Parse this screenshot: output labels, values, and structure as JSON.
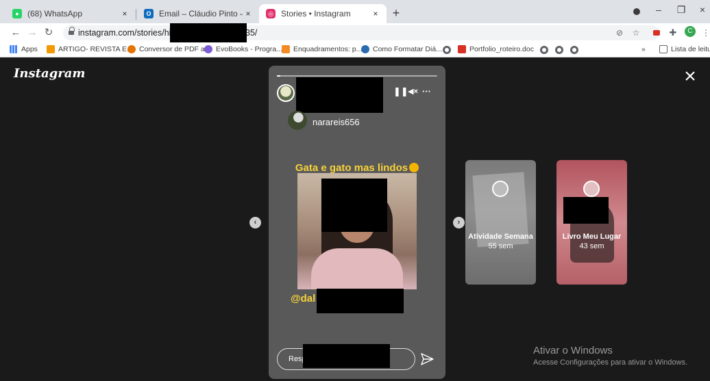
{
  "browser": {
    "tabs": [
      {
        "title": "(68) WhatsApp",
        "close": "×",
        "icon": "whatsapp-icon",
        "color": "#25d366",
        "active": false
      },
      {
        "title": "Email – Cláudio Pinto – Outlook",
        "close": "×",
        "icon": "outlook-icon",
        "color": "#0f6cbd",
        "active": false
      },
      {
        "title": "Stories • Instagram",
        "close": "×",
        "icon": "instagram-icon",
        "color": "#e1306c",
        "active": true
      }
    ],
    "new_tab": "+",
    "window_controls": {
      "minimize": "–",
      "maximize": "❐",
      "close": "×"
    },
    "address": {
      "url_start": "instagram.com/stories/hi",
      "url_end": "35/"
    },
    "bookmarks": [
      {
        "label": "Apps",
        "color": "#4285f4"
      },
      {
        "label": "ARTIGO- REVISTA E...",
        "color": "#f29900"
      },
      {
        "label": "Conversor de PDF a...",
        "color": "#e37400"
      },
      {
        "label": "EvoBooks - Progra...",
        "color": "#7b5cd6"
      },
      {
        "label": "Enquadramentos: p...",
        "color": "#f28b25"
      },
      {
        "label": "Como Formatar Diá...",
        "color": "#2b6cb0"
      },
      {
        "label": "Portfolio_roteiro.doc",
        "color": "#d93025"
      }
    ],
    "bookmarks_more": "»",
    "reading_list": "Lista de leitura",
    "profile_initial": "C"
  },
  "instagram": {
    "logo": "Instagram",
    "close": "×",
    "story": {
      "progress": 0.02,
      "shared_username": "narareis656",
      "caption": "Gata e gato mas lindos",
      "mention": "@dal",
      "reply_placeholder": "Resp",
      "pause": "⏸",
      "mute": "🔇",
      "more": "···"
    },
    "nav": {
      "prev": "‹",
      "next": "›"
    },
    "previews": [
      {
        "title": "Atividade Semana",
        "time": "55 sem",
        "color": "#6b6b6b"
      },
      {
        "title": "Livro Meu Lugar",
        "time": "43 sem",
        "color": "#c06a76"
      }
    ]
  },
  "windows_watermark": {
    "title": "Ativar o Windows",
    "subtitle": "Acesse Configurações para ativar o Windows."
  }
}
